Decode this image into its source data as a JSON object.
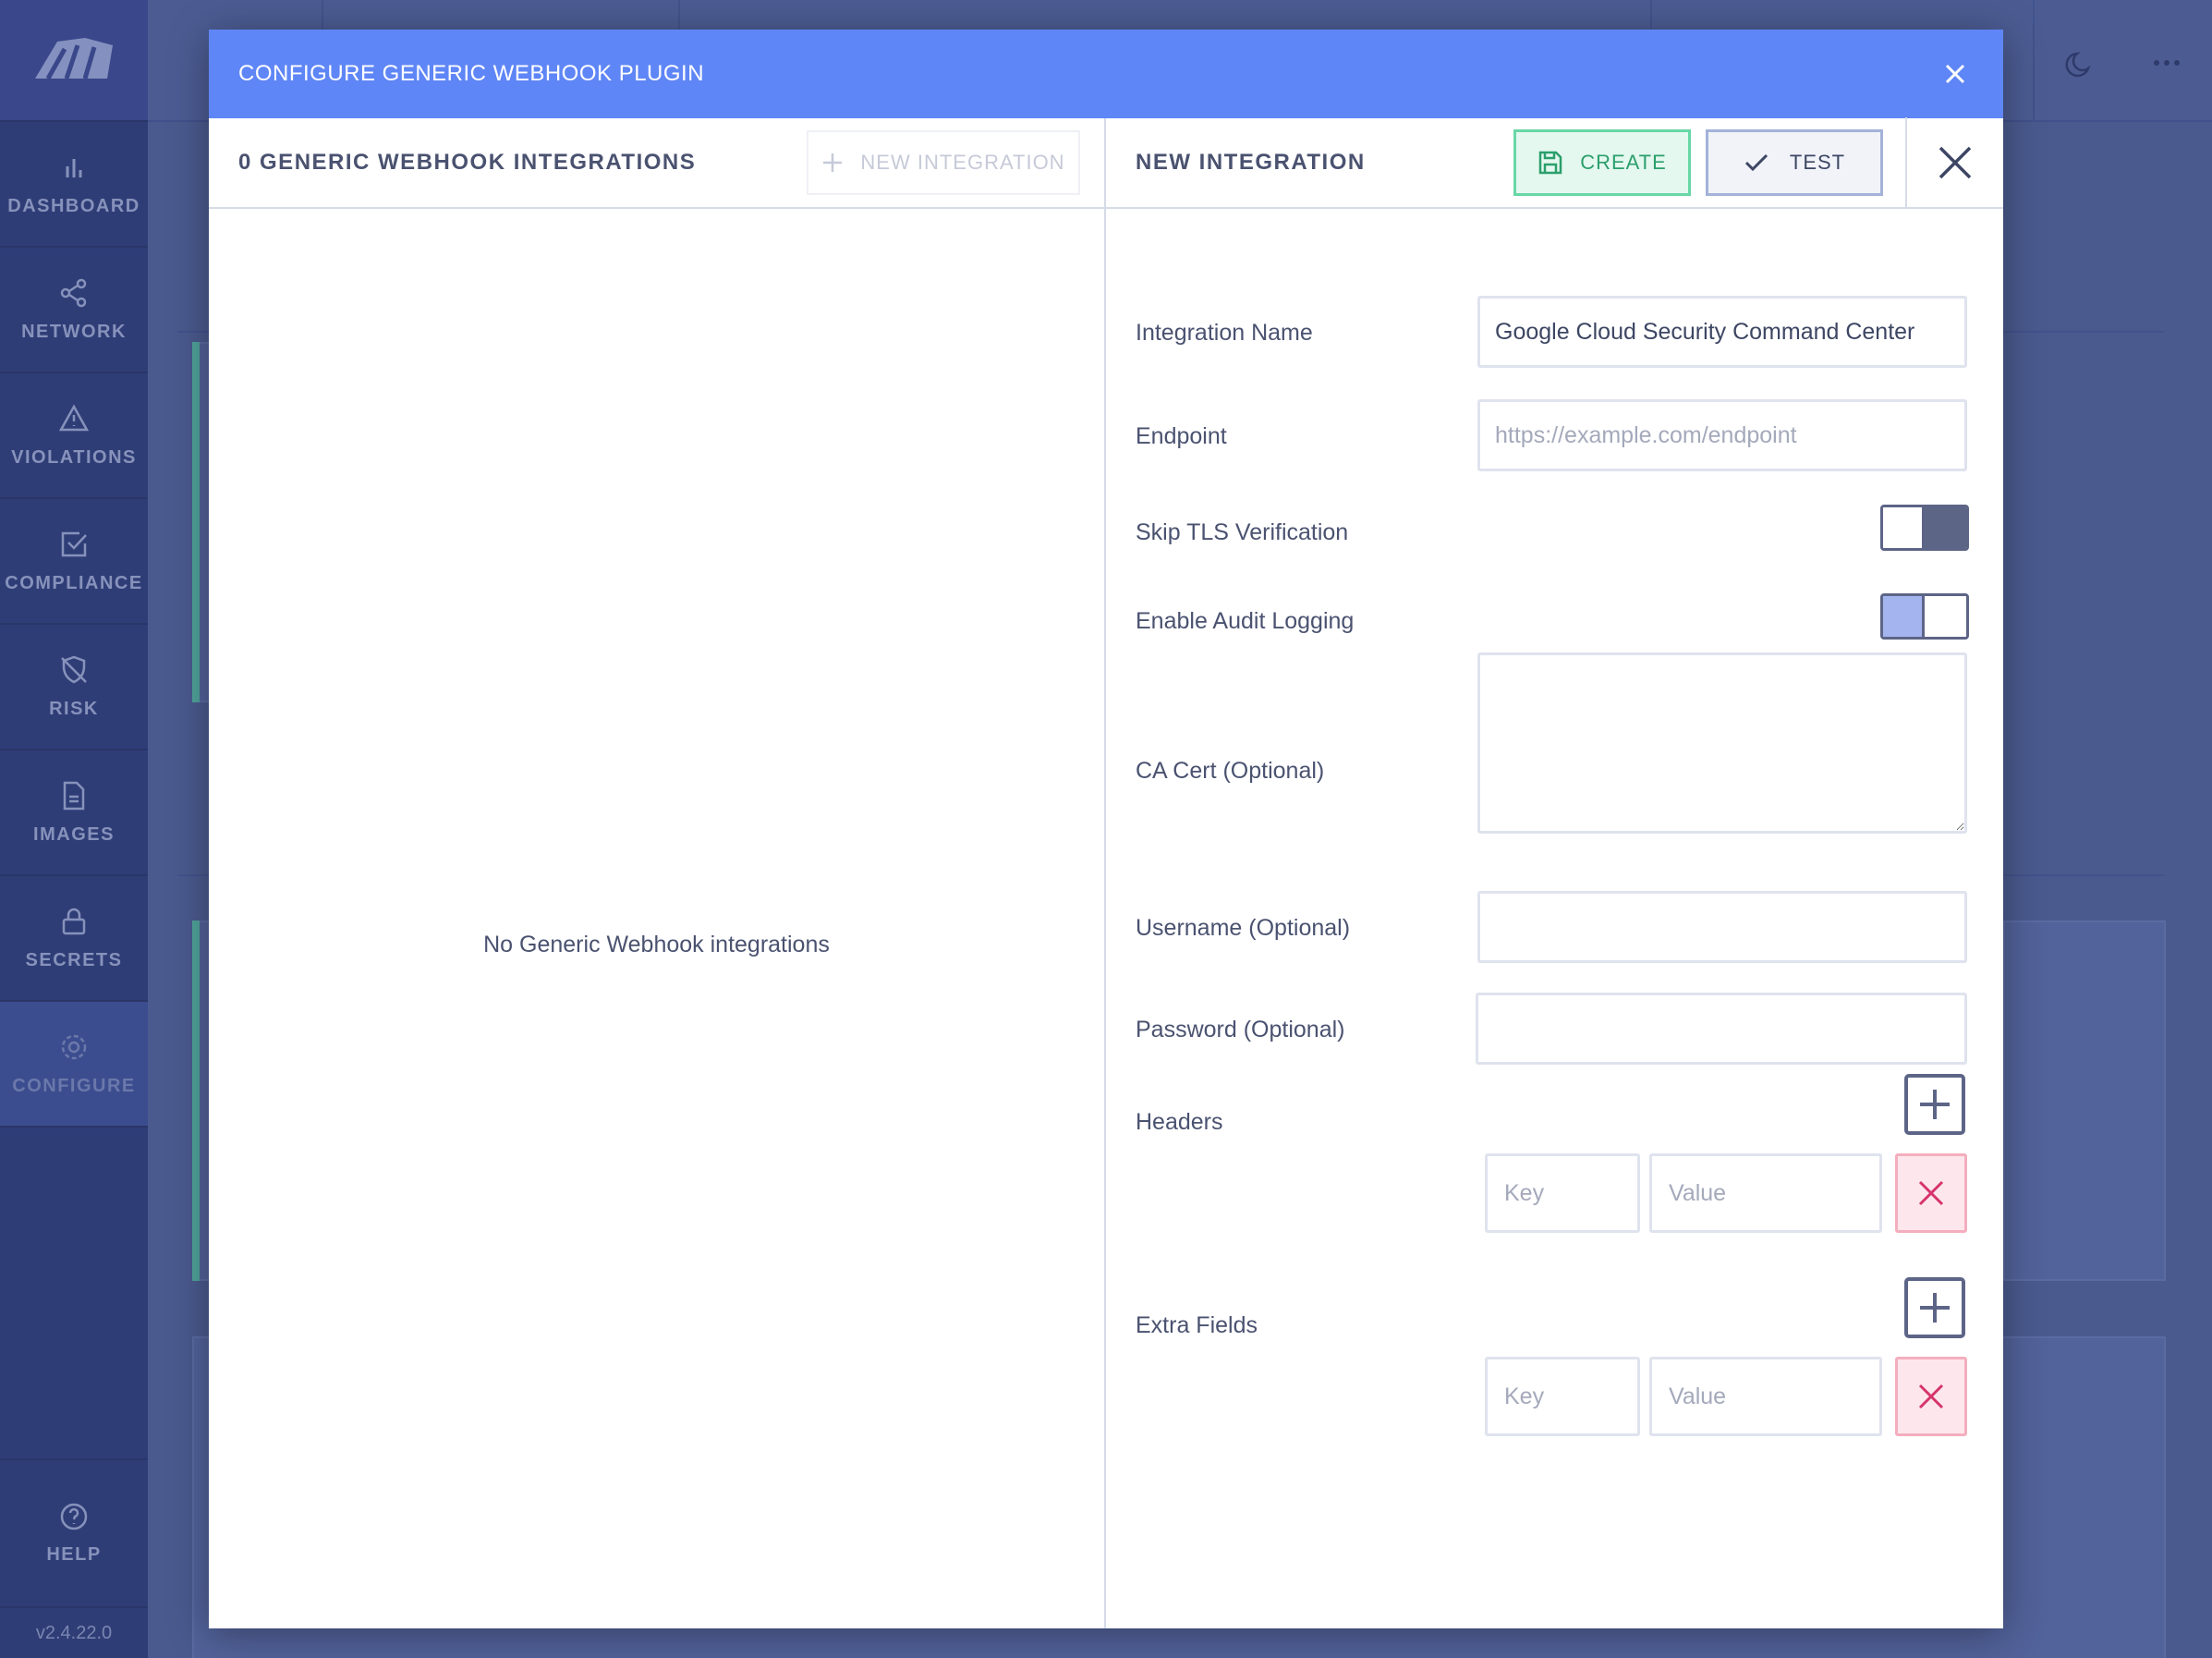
{
  "sidebar": {
    "items": [
      {
        "label": "DASHBOARD",
        "icon": "bar-chart-icon"
      },
      {
        "label": "NETWORK",
        "icon": "share-icon"
      },
      {
        "label": "VIOLATIONS",
        "icon": "alert-triangle-icon"
      },
      {
        "label": "COMPLIANCE",
        "icon": "check-square-icon"
      },
      {
        "label": "RISK",
        "icon": "shield-off-icon"
      },
      {
        "label": "IMAGES",
        "icon": "file-icon"
      },
      {
        "label": "SECRETS",
        "icon": "lock-icon"
      },
      {
        "label": "CONFIGURE",
        "icon": "gear-icon",
        "active": true
      }
    ],
    "help_label": "HELP",
    "version": "v2.4.22.0"
  },
  "modal": {
    "title": "CONFIGURE GENERIC WEBHOOK PLUGIN",
    "left": {
      "title": "0 GENERIC WEBHOOK INTEGRATIONS",
      "new_button": "NEW INTEGRATION",
      "empty_message": "No Generic Webhook integrations"
    },
    "right": {
      "title": "NEW INTEGRATION",
      "create_button": "CREATE",
      "test_button": "TEST"
    },
    "form": {
      "integration_name": {
        "label": "Integration Name",
        "value": "Google Cloud Security Command Center"
      },
      "endpoint": {
        "label": "Endpoint",
        "placeholder": "https://example.com/endpoint"
      },
      "skip_tls": {
        "label": "Skip TLS Verification",
        "enabled": false
      },
      "audit_logging": {
        "label": "Enable Audit Logging",
        "enabled": true
      },
      "ca_cert": {
        "label": "CA Cert (Optional)"
      },
      "username": {
        "label": "Username (Optional)"
      },
      "password": {
        "label": "Password (Optional)"
      },
      "headers": {
        "label": "Headers",
        "key_placeholder": "Key",
        "value_placeholder": "Value"
      },
      "extra_fields": {
        "label": "Extra Fields",
        "key_placeholder": "Key",
        "value_placeholder": "Value"
      }
    }
  },
  "colors": {
    "header": "#5f86f6",
    "create_green": "#2b9f6c",
    "delete_red": "#d6336c",
    "toggle_on": "#a4b4ef"
  }
}
